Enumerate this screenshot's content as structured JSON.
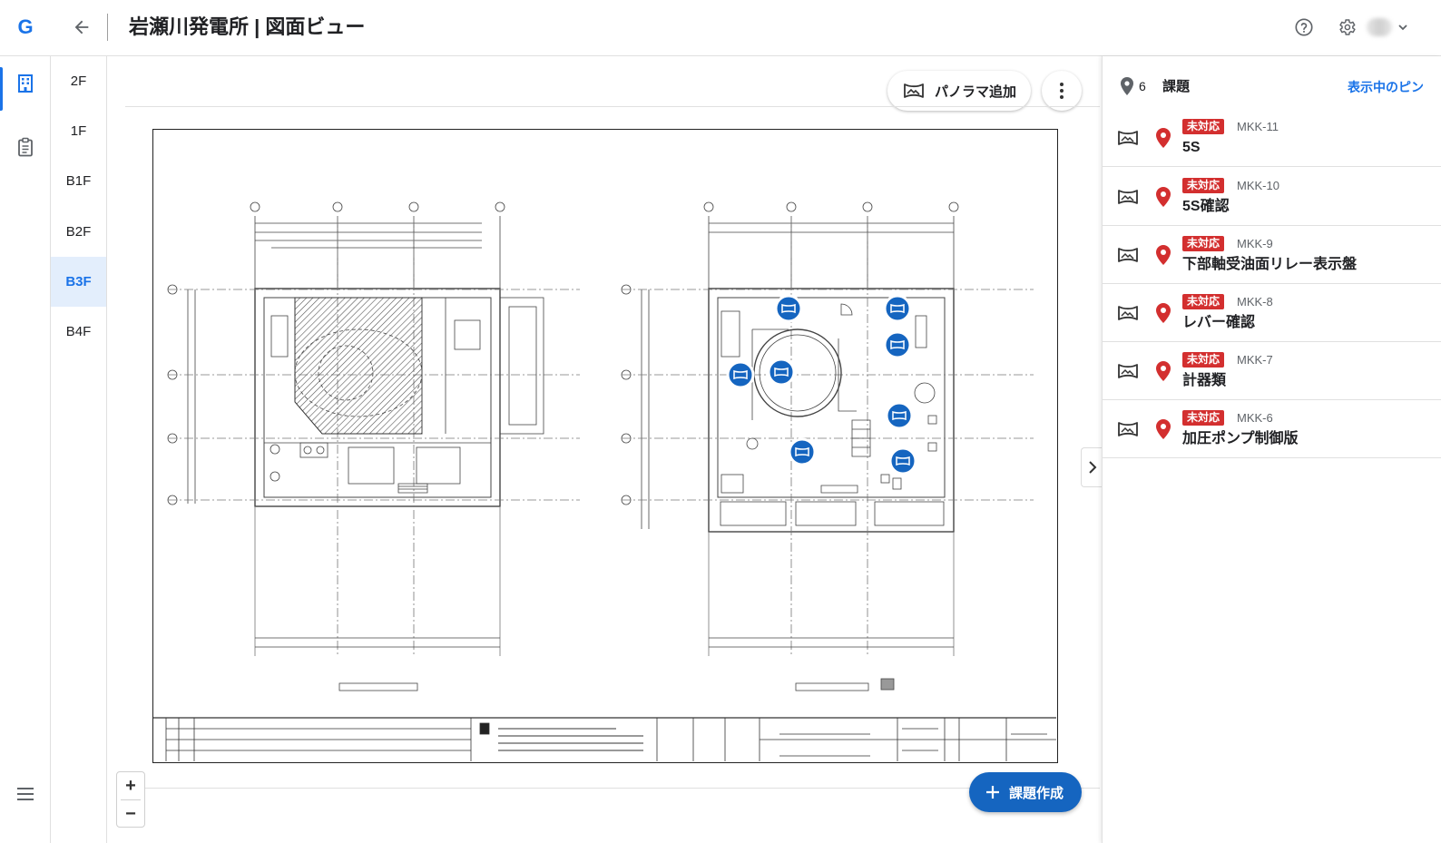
{
  "app": {
    "logo_letter": "G"
  },
  "header": {
    "title": "岩瀬川発電所 | 図面ビュー"
  },
  "floors": [
    "2F",
    "1F",
    "B1F",
    "B2F",
    "B3F",
    "B4F"
  ],
  "active_floor": "B3F",
  "toolbar": {
    "panorama_label": "パノラマ追加",
    "create_label": "課題作成",
    "zoom_in": "+",
    "zoom_out": "−"
  },
  "panel": {
    "pin_count": "6",
    "title": "課題",
    "filter_link": "表示中のピン",
    "issues": [
      {
        "status": "未対応",
        "code": "MKK-11",
        "name": "5S"
      },
      {
        "status": "未対応",
        "code": "MKK-10",
        "name": "5S確認"
      },
      {
        "status": "未対応",
        "code": "MKK-9",
        "name": "下部軸受油面リレー表示盤"
      },
      {
        "status": "未対応",
        "code": "MKK-8",
        "name": "レバー確認"
      },
      {
        "status": "未対応",
        "code": "MKK-7",
        "name": "計器類"
      },
      {
        "status": "未対応",
        "code": "MKK-6",
        "name": "加圧ポンプ制御版"
      }
    ]
  },
  "colors": {
    "accent": "#1a73e8",
    "status_red": "#d32f2f",
    "pin_red": "#d32f2f",
    "marker_blue": "#1565c0"
  }
}
